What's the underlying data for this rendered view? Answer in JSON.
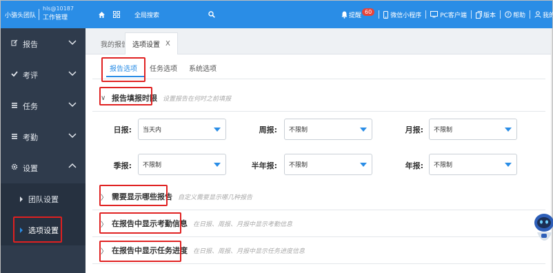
{
  "brand": {
    "team_name": "小骆头团队",
    "account": "hls@10187",
    "role": "工作管理"
  },
  "sidebar": {
    "items": [
      {
        "icon": "edit-icon",
        "label": "报告"
      },
      {
        "icon": "check-icon",
        "label": "考评"
      },
      {
        "icon": "list-icon",
        "label": "任务"
      },
      {
        "icon": "list-icon",
        "label": "考勤"
      },
      {
        "icon": "gear-icon",
        "label": "设置"
      }
    ],
    "subitems": [
      {
        "label": "团队设置"
      },
      {
        "label": "选项设置"
      }
    ]
  },
  "topbar": {
    "home_icon": "home-icon",
    "grid_icon": "grid-icon",
    "search_label": "全局搜索",
    "search_icon": "search-icon",
    "remind_label": "提醒",
    "remind_count": "60",
    "miniapp_label": "微信小程序",
    "pc_label": "PC客户端",
    "version_label": "版本",
    "help_label": "帮助",
    "mine_label": "我的"
  },
  "page_tabs": [
    {
      "label": "我的报告"
    },
    {
      "label": "选项设置",
      "close": "X"
    }
  ],
  "sub_tabs": [
    {
      "label": "报告选项"
    },
    {
      "label": "任务选项"
    },
    {
      "label": "系统选项"
    }
  ],
  "sections": [
    {
      "arrow": "∨",
      "title": "报告填报时限",
      "hint": "设置报告在何时之前填报"
    },
    {
      "arrow": "〉",
      "title": "需要显示哪些报告",
      "hint": "自定义需要显示哪几种报告"
    },
    {
      "arrow": "〉",
      "title": "在报告中显示考勤信息",
      "hint": "在日报、周报、月报中显示考勤信息"
    },
    {
      "arrow": "〉",
      "title": "在报告中显示任务进度",
      "hint": "在日报、周报、月报中显示任务进度信息"
    }
  ],
  "fields": [
    {
      "label": "日报:",
      "value": "当天内"
    },
    {
      "label": "周报:",
      "value": "不限制"
    },
    {
      "label": "月报:",
      "value": "不限制"
    },
    {
      "label": "季报:",
      "value": "不限制"
    },
    {
      "label": "半年报:",
      "value": "不限制"
    },
    {
      "label": "年报:",
      "value": "不限制"
    }
  ],
  "colors": {
    "accent": "#2a8de6",
    "sidebar": "#2f3b4c",
    "highlight_box": "#e02020",
    "badge": "#e8443a"
  }
}
